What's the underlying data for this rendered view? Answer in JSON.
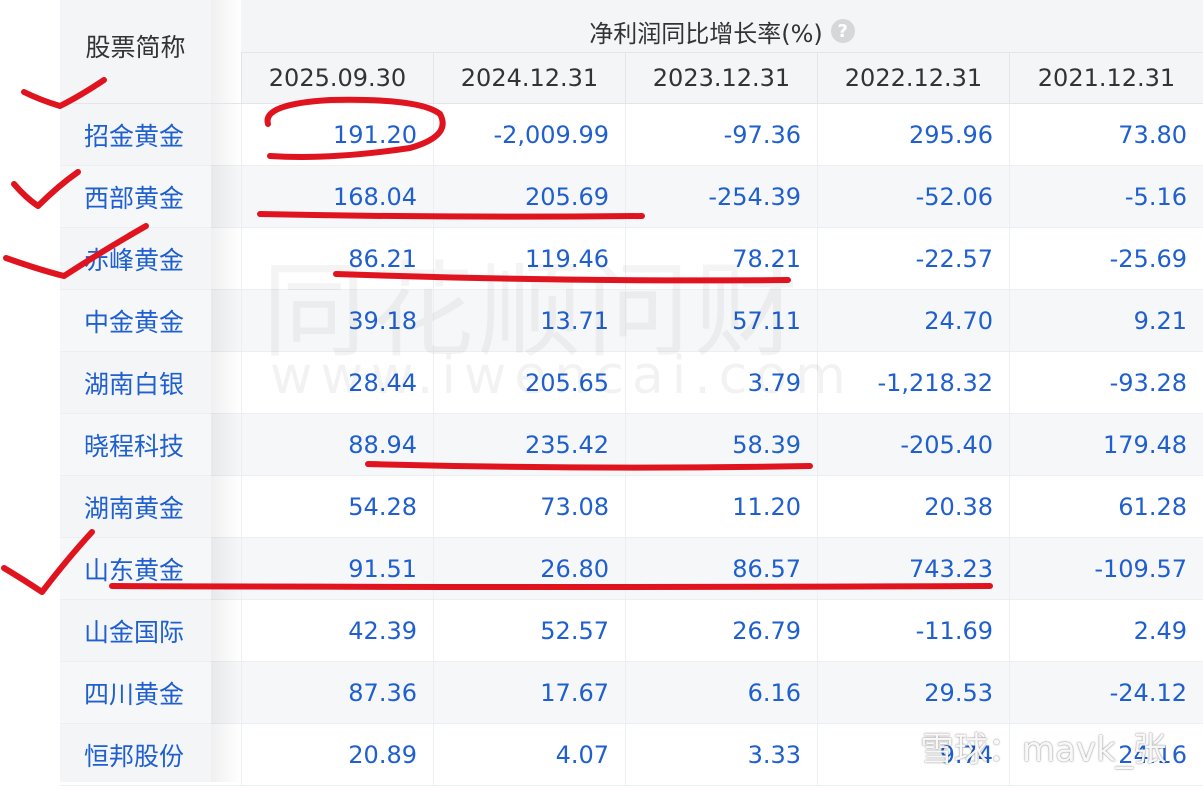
{
  "table": {
    "name_header": "股票简称",
    "group_title": "净利润同比增长率(%)",
    "help_glyph": "?",
    "dates": [
      "2025.09.30",
      "2024.12.31",
      "2023.12.31",
      "2022.12.31",
      "2021.12.31"
    ],
    "rows": [
      {
        "name": "招金黄金",
        "values": [
          "191.20",
          "-2,009.99",
          "-97.36",
          "295.96",
          "73.80"
        ]
      },
      {
        "name": "西部黄金",
        "values": [
          "168.04",
          "205.69",
          "-254.39",
          "-52.06",
          "-5.16"
        ]
      },
      {
        "name": "赤峰黄金",
        "values": [
          "86.21",
          "119.46",
          "78.21",
          "-22.57",
          "-25.69"
        ]
      },
      {
        "name": "中金黄金",
        "values": [
          "39.18",
          "13.71",
          "57.11",
          "24.70",
          "9.21"
        ]
      },
      {
        "name": "湖南白银",
        "values": [
          "28.44",
          "205.65",
          "3.79",
          "-1,218.32",
          "-93.28"
        ]
      },
      {
        "name": "晓程科技",
        "values": [
          "88.94",
          "235.42",
          "58.39",
          "-205.40",
          "179.48"
        ]
      },
      {
        "name": "湖南黄金",
        "values": [
          "54.28",
          "73.08",
          "11.20",
          "20.38",
          "61.28"
        ]
      },
      {
        "name": "山东黄金",
        "values": [
          "91.51",
          "26.80",
          "86.57",
          "743.23",
          "-109.57"
        ]
      },
      {
        "name": "山金国际",
        "values": [
          "42.39",
          "52.57",
          "26.79",
          "-11.69",
          "2.49"
        ]
      },
      {
        "name": "四川黄金",
        "values": [
          "87.36",
          "17.67",
          "6.16",
          "29.53",
          "-24.12"
        ]
      },
      {
        "name": "恒邦股份",
        "values": [
          "20.89",
          "4.07",
          "3.33",
          "9.74",
          "24.16"
        ]
      }
    ]
  },
  "watermark": {
    "line1": "同花顺问财",
    "line2": "www.iwencai.com"
  },
  "source_mark": "雪球：mavk_张",
  "colors": {
    "value_text": "#1f5fcf",
    "annotation_red": "#e0141e"
  }
}
